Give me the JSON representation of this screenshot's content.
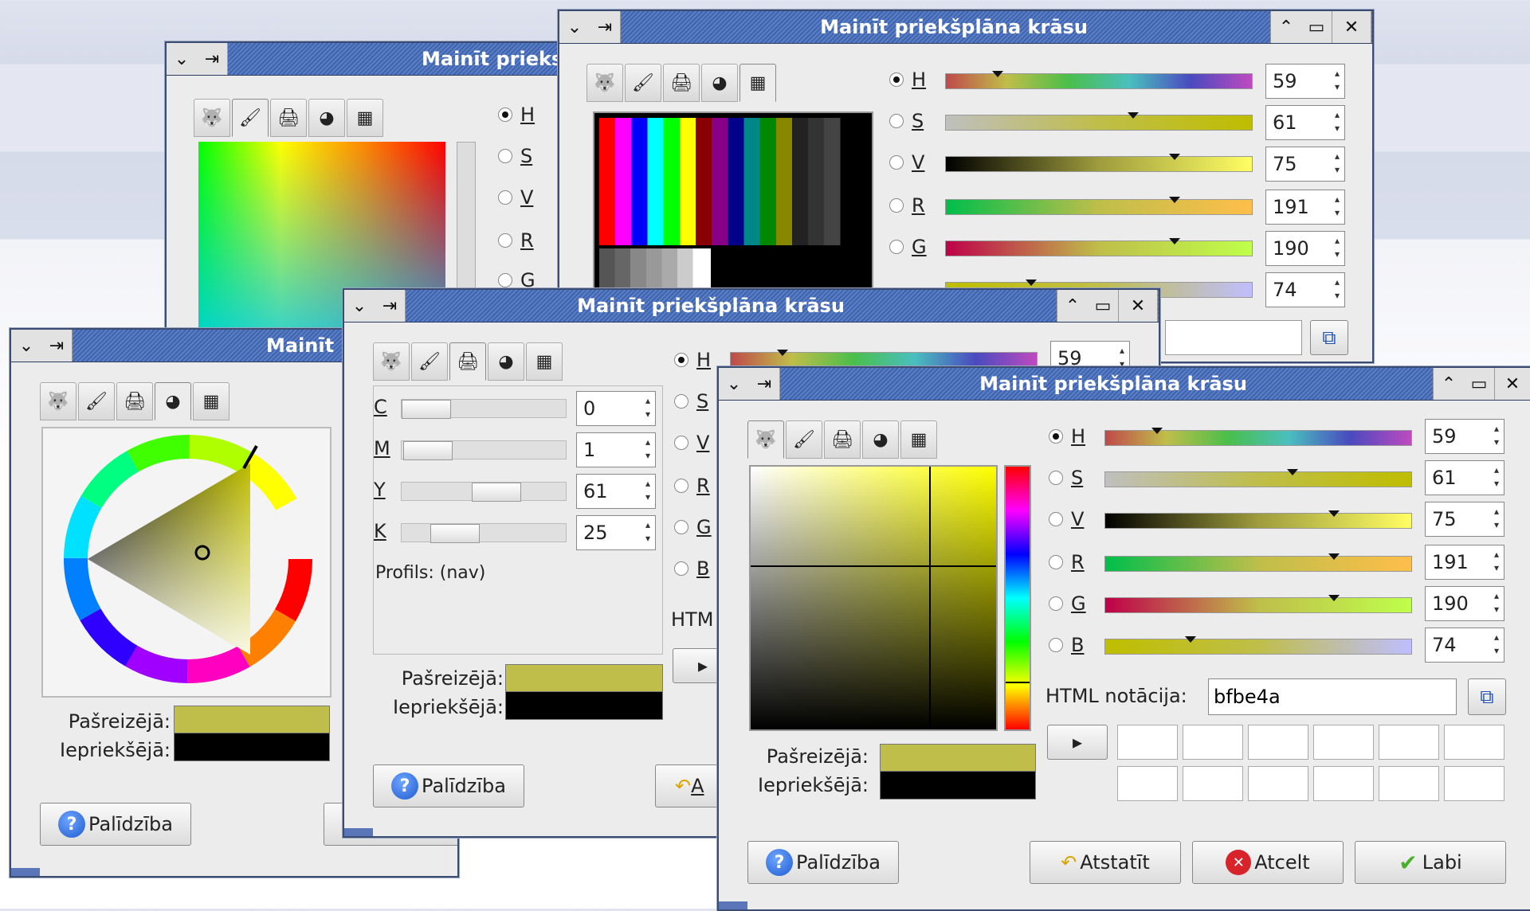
{
  "dialog_title": "Mainīt priekšplāna krāsu",
  "dialog_title_truncated": "Mainīt prieks",
  "dialog_title_short": "Mainīt",
  "tabs": [
    "gimp-icon",
    "brush-icon",
    "printer-icon",
    "color-wheel-icon",
    "palette-icon"
  ],
  "hsv_rgb": {
    "labels": {
      "h": "H",
      "s": "S",
      "v": "V",
      "r": "R",
      "g": "G",
      "b": "B"
    },
    "values": {
      "h": "59",
      "s": "61",
      "v": "75",
      "r": "191",
      "g": "190",
      "b": "74"
    }
  },
  "cmyk": {
    "labels": {
      "c": "C",
      "m": "M",
      "y": "Y",
      "k": "K"
    },
    "values": {
      "c": "0",
      "m": "1",
      "y": "61",
      "k": "25"
    },
    "profile": "Profils: (nav)"
  },
  "html_notation": {
    "label": "HTML notācija:",
    "value": "bfbe4a",
    "label_truncated": "HTM"
  },
  "swatches": {
    "current_label": "Pašreizējā:",
    "previous_label": "Iepriekšējā:",
    "current_color": "#bfbe4a",
    "previous_color": "#000000"
  },
  "buttons": {
    "help": "Palīdzība",
    "reset": "Atstatīt",
    "cancel": "Atcelt",
    "ok": "Labi",
    "reset_partial": "A"
  },
  "colors": {
    "titlebar": "#4a6db5",
    "current": "#bfbe4a"
  }
}
